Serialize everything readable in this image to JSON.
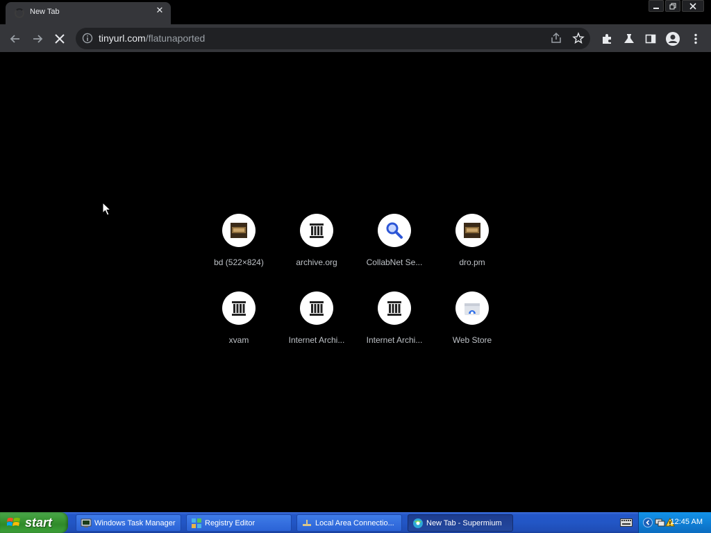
{
  "browser": {
    "tab_title": "New Tab",
    "url_host": "tinyurl.com",
    "url_path": "/flatunaported"
  },
  "shortcuts": [
    {
      "label": "bd (522×824)",
      "icon": "thumbnail-icon"
    },
    {
      "label": "archive.org",
      "icon": "archive-building-icon"
    },
    {
      "label": "CollabNet Se...",
      "icon": "search-icon"
    },
    {
      "label": "dro.pm",
      "icon": "thumbnail-icon"
    },
    {
      "label": "xvam",
      "icon": "archive-building-icon"
    },
    {
      "label": "Internet Archi...",
      "icon": "archive-building-icon"
    },
    {
      "label": "Internet Archi...",
      "icon": "archive-building-icon"
    },
    {
      "label": "Web Store",
      "icon": "web-store-icon"
    }
  ],
  "taskbar": {
    "start_label": "start",
    "tasks": [
      {
        "label": "Windows Task Manager",
        "icon": "task-manager-icon"
      },
      {
        "label": "Registry Editor",
        "icon": "registry-editor-icon"
      },
      {
        "label": "Local Area Connectio...",
        "icon": "network-icon"
      },
      {
        "label": "New Tab - Supermium",
        "icon": "browser-icon"
      }
    ],
    "clock": "12:45 AM"
  },
  "colors": {
    "toolbar_bg": "#35363a",
    "omnibox_bg": "#202124",
    "taskbar_blue": "#2256c5",
    "start_green": "#36922f",
    "tray_blue": "#0f80d6"
  }
}
